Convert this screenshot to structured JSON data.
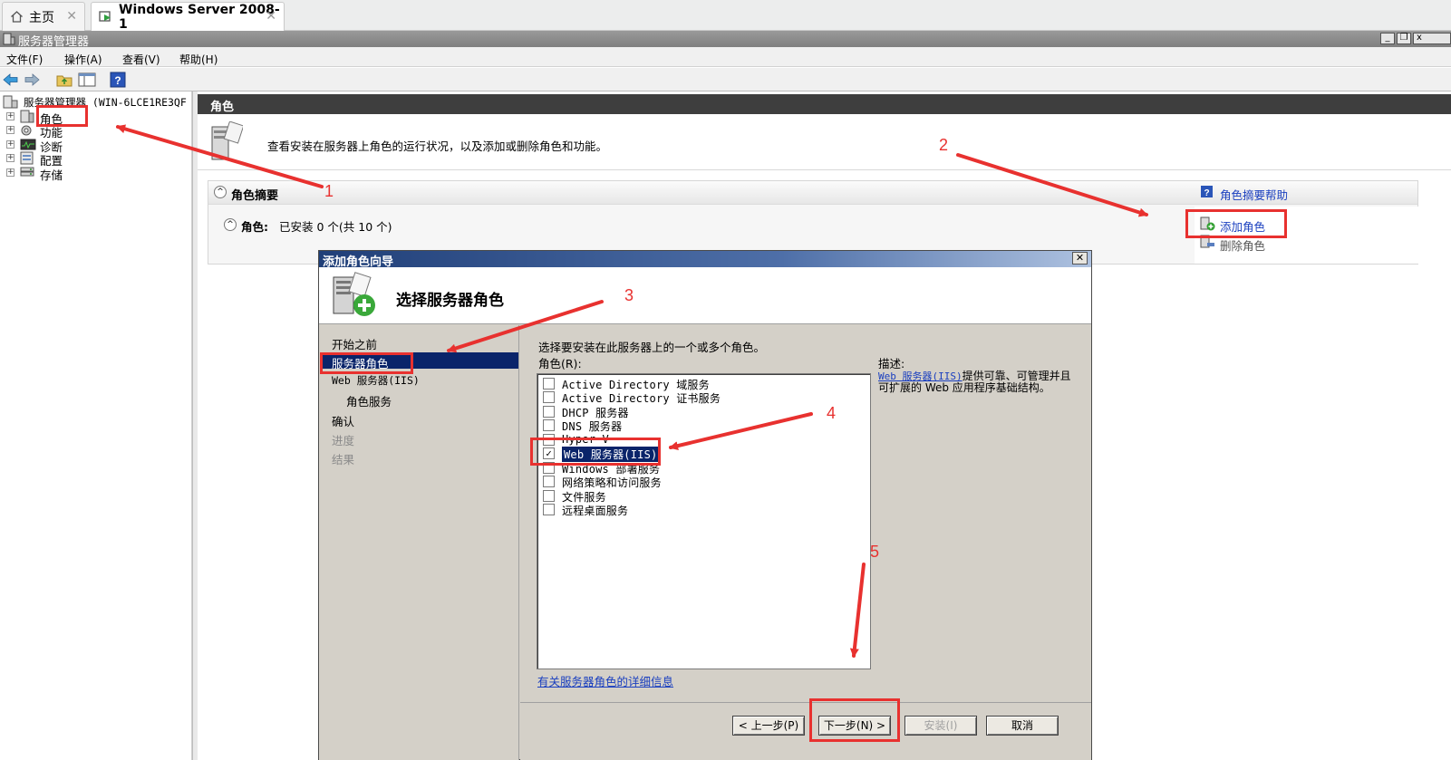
{
  "vmware_tabs": [
    {
      "label": "主页",
      "icon": "home-icon"
    },
    {
      "label": "Windows Server 2008-1",
      "icon": "vm-icon"
    }
  ],
  "window": {
    "title": "服务器管理器",
    "controls": [
      "_",
      "❐",
      "x"
    ]
  },
  "menu": [
    "文件(F)",
    "操作(A)",
    "查看(V)",
    "帮助(H)"
  ],
  "toolbar_icons": [
    "back-arrow-icon",
    "forward-arrow-icon",
    "up-folder-icon",
    "show-hide-tree-icon",
    "help-icon"
  ],
  "tree": {
    "root": "服务器管理器 (WIN-6LCE1RE3QF",
    "items": [
      {
        "label": "角色",
        "icon": "roles-icon"
      },
      {
        "label": "功能",
        "icon": "features-icon"
      },
      {
        "label": "诊断",
        "icon": "diagnostics-icon"
      },
      {
        "label": "配置",
        "icon": "configuration-icon"
      },
      {
        "label": "存储",
        "icon": "storage-icon"
      }
    ]
  },
  "right_pane": {
    "header": "角色",
    "info": "查看安装在服务器上角色的运行状况，以及添加或删除角色和功能。",
    "summary_title": "角色摘要",
    "summary_help": "角色摘要帮助",
    "roles_label": "角色:",
    "roles_status": "已安装 0 个(共 10 个)",
    "actions": [
      "添加角色",
      "删除角色"
    ]
  },
  "wizard": {
    "title": "添加角色向导",
    "heading": "选择服务器角色",
    "steps": [
      {
        "label": "开始之前",
        "state": "normal"
      },
      {
        "label": "服务器角色",
        "state": "selected"
      },
      {
        "label": "Web 服务器(IIS)",
        "state": "normal"
      },
      {
        "label": "角色服务",
        "state": "sub"
      },
      {
        "label": "确认",
        "state": "normal"
      },
      {
        "label": "进度",
        "state": "disabled"
      },
      {
        "label": "结果",
        "state": "disabled"
      }
    ],
    "instruction": "选择要安装在此服务器上的一个或多个角色。",
    "roles_caption": "角色(R):",
    "roles": [
      {
        "label": "Active Directory 域服务",
        "checked": false
      },
      {
        "label": "Active Directory 证书服务",
        "checked": false
      },
      {
        "label": "DHCP 服务器",
        "checked": false
      },
      {
        "label": "DNS 服务器",
        "checked": false
      },
      {
        "label": "Hyper-V",
        "checked": false
      },
      {
        "label": "Web 服务器(IIS)",
        "checked": true
      },
      {
        "label": "Windows 部署服务",
        "checked": false
      },
      {
        "label": "网络策略和访问服务",
        "checked": false
      },
      {
        "label": "文件服务",
        "checked": false
      },
      {
        "label": "远程桌面服务",
        "checked": false
      }
    ],
    "description_label": "描述:",
    "description_link": "Web 服务器(IIS)",
    "description_text": "提供可靠、可管理并且可扩展的 Web 应用程序基础结构。",
    "more_info_link": "有关服务器角色的详细信息",
    "buttons": {
      "prev": "< 上一步(P)",
      "next": "下一步(N) >",
      "install": "安装(I)",
      "cancel": "取消"
    }
  },
  "annotations": {
    "color": "#e8312f",
    "numbers": [
      "1",
      "2",
      "3",
      "4",
      "5"
    ]
  }
}
